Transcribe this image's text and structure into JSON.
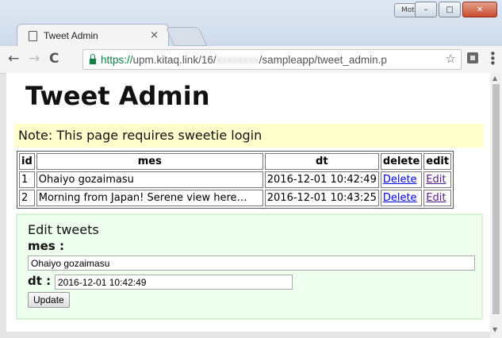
{
  "browser": {
    "profile_button": "Motoki",
    "tab_title": "Tweet Admin",
    "tab_close": "×",
    "url_secure": "https://",
    "url_host": "upm.kitaq.link/16/",
    "url_blurred": "xxxxxxxx",
    "url_path": "/sampleapp/tweet_admin.p",
    "back_icon": "←",
    "forward_icon": "→",
    "reload_icon": "C",
    "star_icon": "☆",
    "menu_icon": "⋮"
  },
  "page": {
    "title": "Tweet Admin",
    "note": "Note: This page requires sweetie login"
  },
  "table": {
    "headers": [
      "id",
      "mes",
      "dt",
      "delete",
      "edit"
    ],
    "rows": [
      {
        "id": "1",
        "mes": "Ohaiyo gozaimasu",
        "dt": "2016-12-01 10:42:49",
        "delete": "Delete",
        "edit": "Edit"
      },
      {
        "id": "2",
        "mes": "Morning from Japan! Serene view here…",
        "dt": "2016-12-01 10:43:25",
        "delete": "Delete",
        "edit": "Edit"
      }
    ]
  },
  "edit_form": {
    "heading": "Edit tweets",
    "mes_label": "mes :",
    "mes_value": "Ohaiyo gozaimasu",
    "dt_label": "dt :",
    "dt_value": "2016-12-01 10:42:49",
    "update_label": "Update"
  }
}
